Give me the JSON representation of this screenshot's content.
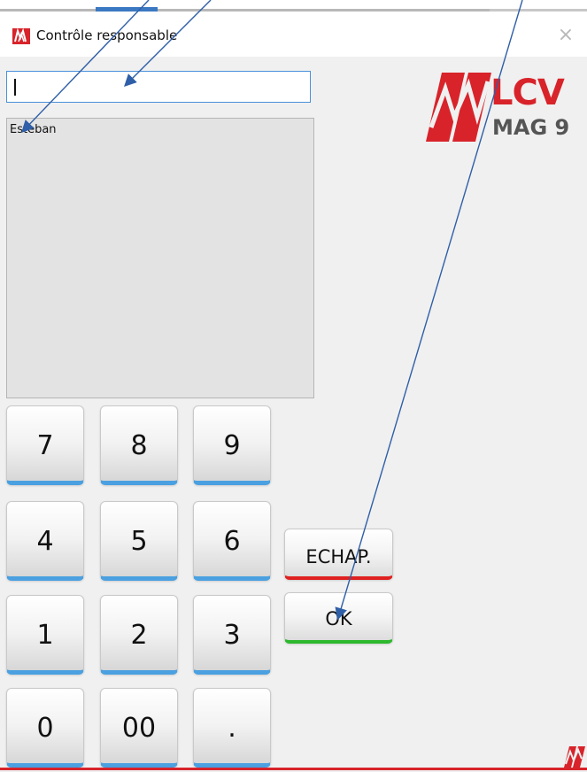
{
  "window": {
    "title": "Contrôle responsable",
    "close_glyph": "×",
    "icon": "lcv-app-icon"
  },
  "search": {
    "value": ""
  },
  "list": {
    "items": [
      "Esteban"
    ]
  },
  "keypad": {
    "keys": [
      "7",
      "8",
      "9",
      "4",
      "5",
      "6",
      "1",
      "2",
      "3",
      "0",
      "00",
      "."
    ]
  },
  "actions": {
    "echap_label": "ECHAP.",
    "ok_label": "OK"
  },
  "logo": {
    "brand": "LCV",
    "product": "MAG 9"
  },
  "colors": {
    "brand_red": "#d8232a",
    "key_underline": "#4aa0e0",
    "echap_underline": "#e02020",
    "ok_underline": "#2eb82e",
    "annotation_arrow": "#2f5fa8"
  }
}
